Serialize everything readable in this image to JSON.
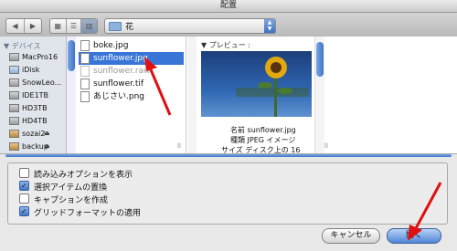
{
  "window": {
    "title": "配置"
  },
  "toolbar": {
    "nav": {
      "back": "◀",
      "forward": "▶"
    },
    "views": [
      {
        "name": "icon-view",
        "glyph": "▦"
      },
      {
        "name": "list-view",
        "glyph": "☰"
      },
      {
        "name": "column-view",
        "glyph": "▥"
      }
    ],
    "path_folder": "花"
  },
  "sidebar": {
    "section": "▼ デバイス",
    "devices": [
      {
        "label": "MacPro16",
        "eject": ""
      },
      {
        "label": "iDisk",
        "eject": ""
      },
      {
        "label": "SnowLeo...",
        "eject": ""
      },
      {
        "label": "IDE1TB",
        "eject": ""
      },
      {
        "label": "HD3TB",
        "eject": ""
      },
      {
        "label": "HD4TB",
        "eject": ""
      },
      {
        "label": "sozai2",
        "eject": "⏏"
      },
      {
        "label": "backup",
        "eject": "⏏"
      }
    ]
  },
  "files": [
    {
      "name": "boke.jpg"
    },
    {
      "name": "sunflower.jpg"
    },
    {
      "name": "sunflower.raw"
    },
    {
      "name": "sunflower.tif"
    },
    {
      "name": "あじさい.png"
    }
  ],
  "preview": {
    "label": "▼ プレビュー :",
    "meta": [
      {
        "key": "名前",
        "value": "sunflower.jpg"
      },
      {
        "key": "種類",
        "value": "JPEG イメージ"
      },
      {
        "key": "サイズ",
        "value": "ディスク上の 16"
      }
    ]
  },
  "options": [
    {
      "label": "読み込みオプションを表示",
      "checked": false
    },
    {
      "label": "選択アイテムの置換",
      "checked": true
    },
    {
      "label": "キャプションを作成",
      "checked": false
    },
    {
      "label": "グリッドフォーマットの適用",
      "checked": true
    }
  ],
  "buttons": {
    "cancel": "キャンセル",
    "open": "開く"
  },
  "colors": {
    "selection": "#3875d7",
    "annotation_arrow": "#e01010"
  }
}
